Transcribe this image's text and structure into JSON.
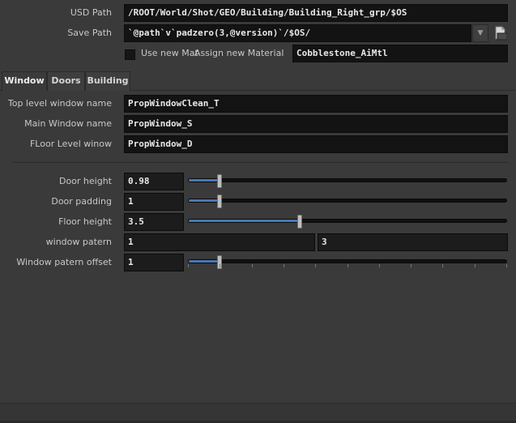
{
  "header": {
    "usd_path": {
      "label": "USD Path",
      "value": "/ROOT/World/Shot/GEO/Building/Building_Right_grp/$OS"
    },
    "save_path": {
      "label": "Save Path",
      "value": "`@path`v`padzero(3,@version)`/$OS/"
    },
    "use_new_mat": {
      "label": "Use new Mat",
      "checked": false
    },
    "assign_material": {
      "label": "Assign new Material",
      "value": "Cobblestone_AiMtl"
    }
  },
  "tabs": [
    {
      "label": "Window",
      "active": true
    },
    {
      "label": "Doors",
      "active": false
    },
    {
      "label": "Building",
      "active": false
    }
  ],
  "window_tab": {
    "names": [
      {
        "label": "Top level window name",
        "value": "PropWindowClean_T"
      },
      {
        "label": "Main Window name",
        "value": "PropWindow_S"
      },
      {
        "label": "FLoor Level winow",
        "value": "PropWindow_D"
      }
    ],
    "door_height": {
      "label": "Door height",
      "value": "0.98",
      "fraction": 0.098
    },
    "door_padding": {
      "label": "Door padding",
      "value": "1",
      "fraction": 0.1
    },
    "floor_height": {
      "label": "Floor height",
      "value": "3.5",
      "fraction": 0.35
    },
    "window_patern": {
      "label": "window patern",
      "value_a": "1",
      "value_b": "3"
    },
    "window_patern_offset": {
      "label": "Window patern offset",
      "value": "1",
      "fraction": 0.1
    }
  },
  "colors": {
    "accent": "#4a79b5",
    "field_bg": "#131313",
    "panel_bg": "#3a3a3a"
  },
  "icons": {
    "dropdown": "chevron-down-icon",
    "file": "file-browse-icon"
  }
}
